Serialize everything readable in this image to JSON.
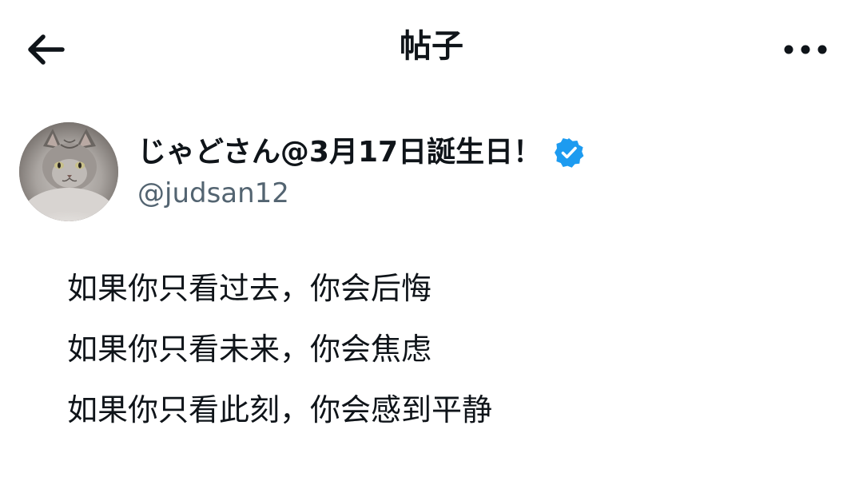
{
  "header": {
    "title": "帖子",
    "back_icon": "arrow-left-icon",
    "more_icon": "more-horizontal-icon"
  },
  "author": {
    "display_name": "じゃどさん@3月17日誕生日！",
    "handle": "@judsan12",
    "verified": true,
    "verified_color": "#1d9bf0",
    "avatar_icon": "cat-avatar"
  },
  "post": {
    "lines": [
      "如果你只看过去，你会后悔",
      "如果你只看未来，你会焦虑",
      "如果你只看此刻，你会感到平静"
    ]
  },
  "colors": {
    "text_primary": "#0f1419",
    "text_secondary": "#536471",
    "background": "#ffffff"
  }
}
